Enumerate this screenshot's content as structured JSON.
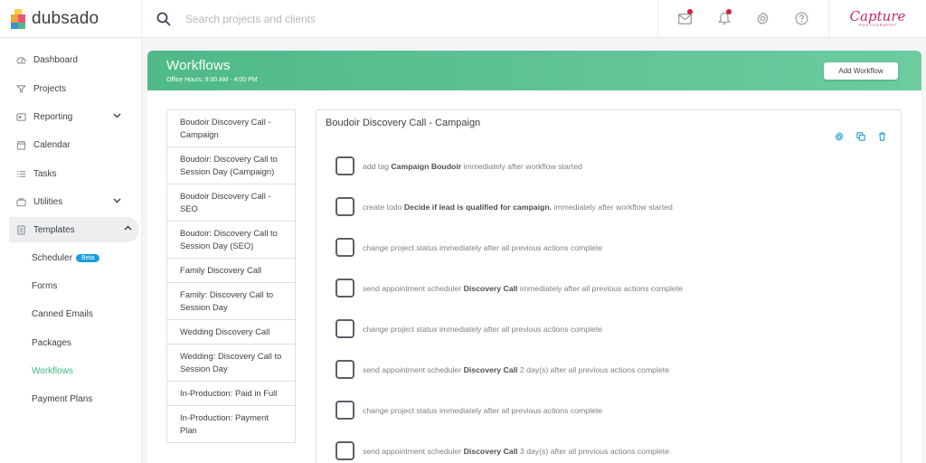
{
  "app": {
    "brand": "dubsado"
  },
  "search": {
    "placeholder": "Search projects and clients"
  },
  "account": {
    "logo_text": "Capture",
    "logo_sub": "PHOTOGRAPHY"
  },
  "sidebar": {
    "items": [
      {
        "label": "Dashboard",
        "icon": "dashboard-icon"
      },
      {
        "label": "Projects",
        "icon": "projects-icon"
      },
      {
        "label": "Reporting",
        "icon": "reporting-icon"
      },
      {
        "label": "Calendar",
        "icon": "calendar-icon"
      },
      {
        "label": "Tasks",
        "icon": "tasks-icon"
      },
      {
        "label": "Utilities",
        "icon": "utilities-icon"
      },
      {
        "label": "Templates",
        "icon": "templates-icon"
      }
    ],
    "templates_sub": [
      {
        "label": "Scheduler",
        "badge": "Beta"
      },
      {
        "label": "Forms"
      },
      {
        "label": "Canned Emails"
      },
      {
        "label": "Packages"
      },
      {
        "label": "Workflows",
        "active": true
      },
      {
        "label": "Payment Plans"
      }
    ]
  },
  "header": {
    "title": "Workflows",
    "office_hours": "Office Hours: 9:00 AM - 4:00 PM",
    "add_button": "Add Workflow"
  },
  "workflow_list": [
    "Boudoir Discovery Call - Campaign",
    "Boudoir: Discovery Call to Session Day (Campaign)",
    "Boudoir Discovery Call - SEO",
    "Boudoir: Discovery Call to Session Day (SEO)",
    "Family Discovery Call",
    "Family: Discovery Call to Session Day",
    "Wedding Discovery Call",
    "Wedding: Discovery Call to Session Day",
    "In-Production: Paid in Full",
    "In-Production: Payment Plan"
  ],
  "detail": {
    "title": "Boudoir Discovery Call - Campaign",
    "steps": [
      {
        "pre": "add tag ",
        "bold": "Campaign Boudoir",
        "post": " immediately after workflow started"
      },
      {
        "pre": "create todo ",
        "bold": "Decide if lead is qualified for campaign.",
        "post": " immediately after workflow started"
      },
      {
        "pre": "change project status immediately after all previous actions complete",
        "bold": "",
        "post": ""
      },
      {
        "pre": "send appointment scheduler ",
        "bold": "Discovery Call",
        "post": " immediately after all previous actions complete"
      },
      {
        "pre": "change project status immediately after all previous actions complete",
        "bold": "",
        "post": ""
      },
      {
        "pre": "send appointment scheduler ",
        "bold": "Discovery Call",
        "post": " 2 day(s) after all previous actions complete"
      },
      {
        "pre": "change project status immediately after all previous actions complete",
        "bold": "",
        "post": ""
      },
      {
        "pre": "send appointment scheduler ",
        "bold": "Discovery Call",
        "post": " 3 day(s) after all previous actions complete"
      }
    ]
  },
  "colors": {
    "accent": "#3dbb83",
    "banner": "#5cc293",
    "badge": "#1a9dd9",
    "notification": "#d21f3c"
  }
}
